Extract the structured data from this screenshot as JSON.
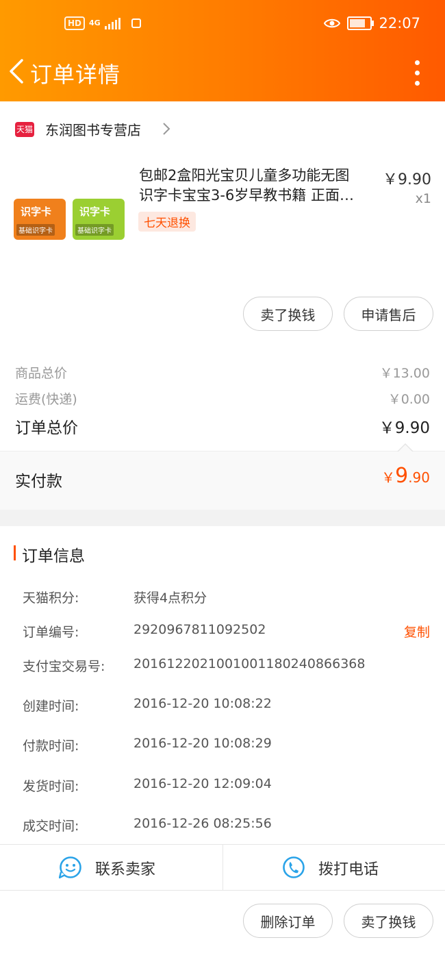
{
  "status_bar": {
    "network": "4G",
    "hd": "HD",
    "time": "22:07"
  },
  "header": {
    "title": "订单详情"
  },
  "store": {
    "badge": "天猫",
    "name": "东润图书专营店"
  },
  "product": {
    "title_line1": "包邮2盒阳光宝贝儿童多功能无图",
    "title_line2": "识字卡宝宝3-6岁早教书籍 正面…",
    "price": "￥9.90",
    "quantity": "x1",
    "tag": "七天退换",
    "thumb_label": "识字卡",
    "thumb_sub": "基础识字卡"
  },
  "actions": {
    "sell": "卖了换钱",
    "after_sale": "申请售后"
  },
  "summary": {
    "goods_total_label": "商品总价",
    "goods_total": "￥13.00",
    "shipping_label": "运费(快递)",
    "shipping": "￥0.00",
    "order_total_label": "订单总价",
    "order_total": "￥9.90"
  },
  "paid": {
    "label": "实付款",
    "currency": "￥",
    "int": "9",
    "dec": ".90"
  },
  "order_info": {
    "title": "订单信息",
    "copy": "复制",
    "rows": [
      {
        "key": "天猫积分:",
        "value": "获得4点积分"
      },
      {
        "key": "订单编号:",
        "value": "2920967811092502"
      },
      {
        "key": "支付宝交易号:",
        "value": "2016122021001001180240866368"
      },
      {
        "key": "创建时间:",
        "value": "2016-12-20 10:08:22"
      },
      {
        "key": "付款时间:",
        "value": "2016-12-20 10:08:29"
      },
      {
        "key": "发货时间:",
        "value": "2016-12-20 12:09:04"
      },
      {
        "key": "成交时间:",
        "value": "2016-12-26 08:25:56"
      }
    ]
  },
  "bottom_bar": {
    "contact_seller": "联系卖家",
    "call": "拨打电话",
    "delete_order": "删除订单",
    "sell": "卖了换钱"
  },
  "colors": {
    "brand_orange": "#ff5000",
    "header_start": "#ff9a00",
    "header_end": "#ff5a00",
    "icon_blue": "#2aa3e8"
  }
}
